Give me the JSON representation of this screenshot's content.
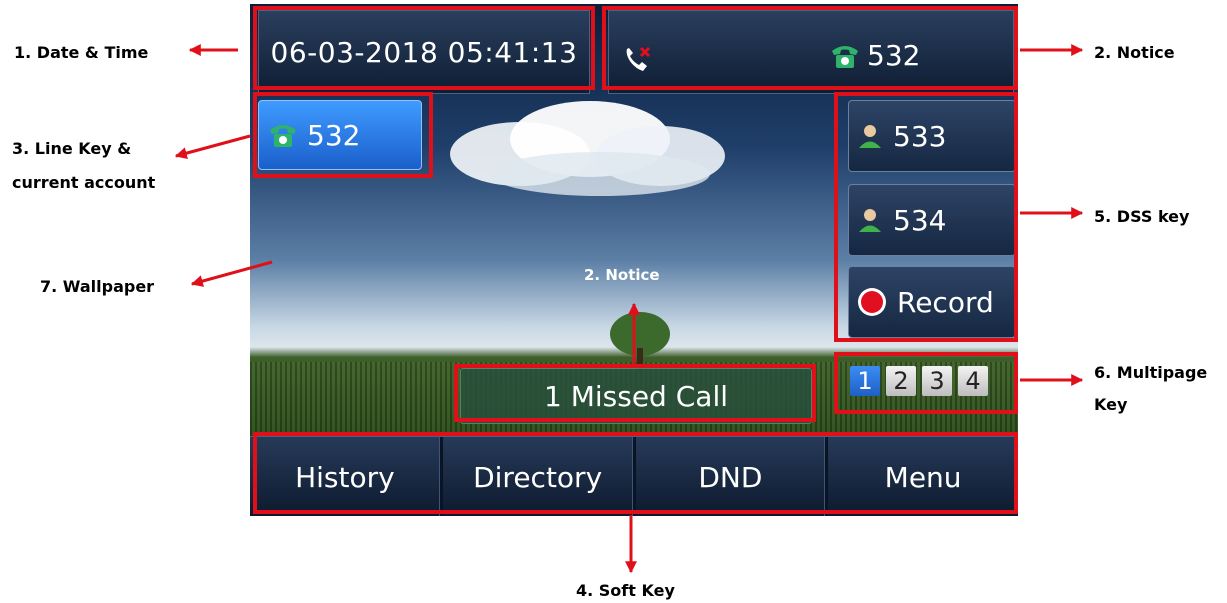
{
  "callouts": {
    "date_time": "1. Date & Time",
    "notice": "2. Notice",
    "line_key_1": "3. Line Key &",
    "line_key_2": "current account",
    "wallpaper": "7. Wallpaper",
    "dss_key": "5. DSS key",
    "multipage_1": "6. Multipage",
    "multipage_2": "Key",
    "soft_key": "4. Soft Key",
    "notice_inner": "2. Notice"
  },
  "phone": {
    "datetime": "06-03-2018 05:41:13",
    "notice_account": "532",
    "line_key": "532",
    "dss_keys": [
      "533",
      "534",
      "Record"
    ],
    "pages": [
      "1",
      "2",
      "3",
      "4"
    ],
    "active_page": "1",
    "notice_message": "1 Missed Call",
    "softkeys": [
      "History",
      "Directory",
      "DND",
      "Menu"
    ]
  },
  "colors": {
    "highlight": "#e0101a",
    "line_key": "#2a7be6",
    "phone_icon": "#2fb36a",
    "record": "#e01020"
  },
  "icons": [
    "missed-call-icon",
    "phone-icon",
    "contact-icon",
    "record-icon"
  ]
}
